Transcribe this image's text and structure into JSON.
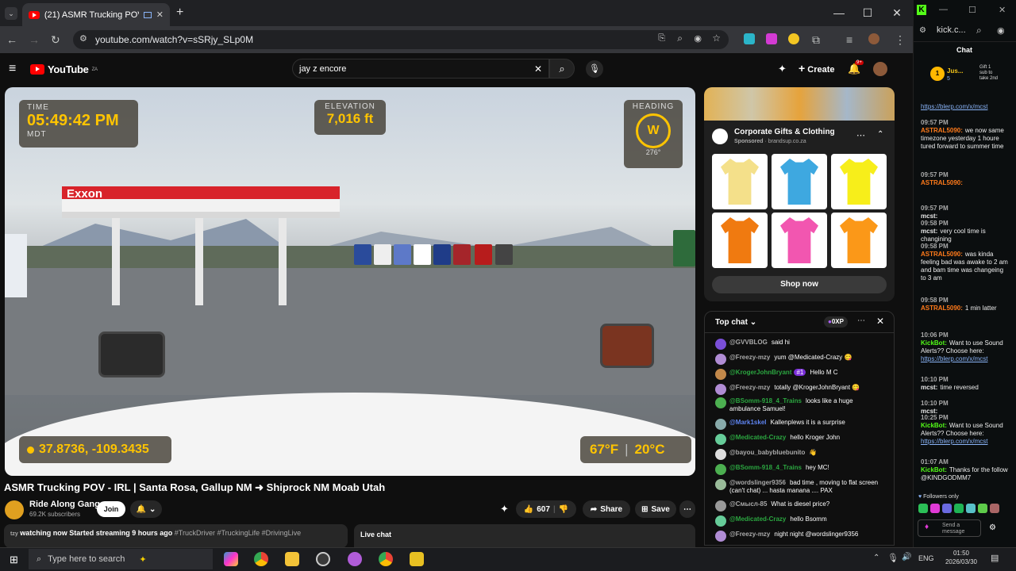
{
  "browser": {
    "tab_title": "(21) ASMR Trucking POV - I",
    "new_tab": "+",
    "url": "youtube.com/watch?v=sSRjy_SLp0M",
    "win_min": "—",
    "win_max": "☐",
    "win_close": "✕"
  },
  "youtube": {
    "logo": "YouTube",
    "logo_region": "ZA",
    "search_value": "jay z encore",
    "create_label": "Create",
    "notif_count": "9+",
    "video": {
      "time_label": "TIME",
      "time_value": "05:49:42 PM",
      "tz": "MDT",
      "elev_label": "ELEVATION",
      "elev_value": "7,016 ft",
      "heading_label": "HEADING",
      "heading_dir": "W",
      "heading_deg": "276°",
      "gps": "37.8736, -109.3435",
      "temp_f": "67°F",
      "temp_c": "20°C",
      "station_sign": "Exxon"
    },
    "title": "ASMR Trucking POV - IRL | Santa Rosa, Gallup NM ➜ Shiprock NM Moab Utah",
    "channel": "Ride Along Gang",
    "subscribers": "69.2K subscribers",
    "join": "Join",
    "likes": "607",
    "share": "Share",
    "save": "Save",
    "desc_line": "watching now  Started streaming 9 hours ago",
    "desc_tags": "#TruckDriver #TruckingLife #DrivingLive",
    "desc_prefix": "tzy",
    "live_chat": "Live chat",
    "ad": {
      "title": "Corporate Gifts & Clothing",
      "sponsored": "Sponsored",
      "domain": "brandsup.co.za",
      "shop_now": "Shop now",
      "shirt_colors": [
        "#f4e08a",
        "#3ea8e0",
        "#f7ee1a",
        "#f07a10",
        "#f256b0",
        "#fb9818"
      ]
    },
    "chat": {
      "header": "Top chat",
      "xp": "0XP",
      "messages": [
        {
          "user": "@GVVBLOG",
          "text": "said hi",
          "av": "#7a4fd8"
        },
        {
          "user": "@Freezy-mzy",
          "text": "yum @Medicated-Crazy 😋",
          "av": "#b08cd4"
        },
        {
          "user": "@KrogerJohnBryant",
          "text": "Hello M C",
          "av": "#c2884a",
          "badge": "#1"
        },
        {
          "user": "@Freezy-mzy",
          "text": "totally @KrogerJohnBryant 😋",
          "av": "#b08cd4"
        },
        {
          "user": "@BSomm-918_4_Trains",
          "text": "looks like a huge ambulance Samuel!",
          "av": "#4caf50"
        },
        {
          "user": "@Mark1skel",
          "text": "Kallenplews it is a surprise",
          "av": "#8aa"
        },
        {
          "user": "@Medicated-Crazy",
          "text": "hello Kroger John",
          "av": "#6c9"
        },
        {
          "user": "@bayou_babybluebunito",
          "text": "👋",
          "av": "#ddd"
        },
        {
          "user": "@BSomm-918_4_Trains",
          "text": "hey MC!",
          "av": "#4caf50"
        },
        {
          "user": "@wordslinger9356",
          "text": "bad time , moving to flat screen (can't chat) ... hasta manana .... PAX",
          "av": "#9b9"
        },
        {
          "user": "@Смысл-85",
          "text": "What is diesel price?",
          "av": "#999"
        },
        {
          "user": "@Medicated-Crazy",
          "text": "hello Bsomm",
          "av": "#6c9"
        },
        {
          "user": "@Freezy-mzy",
          "text": "night night @wordslinger9356",
          "av": "#b08cd4"
        }
      ]
    }
  },
  "kick": {
    "url": "kick.c...",
    "chat_title": "Chat",
    "pinned_user": "Jus...",
    "pinned_num": "5",
    "gift_text": "Gift 1 sub to take 2nd",
    "followers_only": "Followers only",
    "send_placeholder": "Send a message",
    "messages": [
      {
        "time": "",
        "user": "",
        "text": "",
        "link": "https://blerp.com/x/mcst"
      },
      {
        "time": "09:57 PM",
        "user": "ASTRAL5090:",
        "text": "we now same timezone yesterday 1 houre tured forward to summer time",
        "link": ""
      },
      {
        "time": "09:57 PM",
        "user": "ASTRAL5090:",
        "text": "",
        "link": ""
      },
      {
        "time": "09:57 PM",
        "user": "mcst:",
        "text": "",
        "link": ""
      },
      {
        "time": "09:58 PM",
        "user": "mcst:",
        "text": "very cool time is changining",
        "link": ""
      },
      {
        "time": "09:58 PM",
        "user": "ASTRAL5090:",
        "text": "was kinda feeling bad was awake to 2 am and bam time was changeing to 3 am",
        "link": ""
      },
      {
        "time": "09:58 PM",
        "user": "ASTRAL5090:",
        "text": "1 min latter",
        "link": ""
      },
      {
        "time": "10:06 PM",
        "user": "KickBot:",
        "text": "Want to use Sound Alerts?? Choose here:",
        "link": "https://blerp.com/x/mcst"
      },
      {
        "time": "10:10 PM",
        "user": "mcst:",
        "text": "time reversed",
        "link": ""
      },
      {
        "time": "10:10 PM",
        "user": "mcst:",
        "text": "",
        "link": ""
      },
      {
        "time": "10:25 PM",
        "user": "KickBot:",
        "text": "Want to use Sound Alerts?? Choose here:",
        "link": "https://blerp.com/x/mcst"
      },
      {
        "time": "01:07 AM",
        "user": "KickBot:",
        "text": "Thanks for the follow @KINDGODMM7",
        "link": ""
      }
    ]
  },
  "taskbar": {
    "search_placeholder": "Type here to search",
    "lang": "ENG",
    "time": "01:50",
    "date": "2026/03/30"
  }
}
